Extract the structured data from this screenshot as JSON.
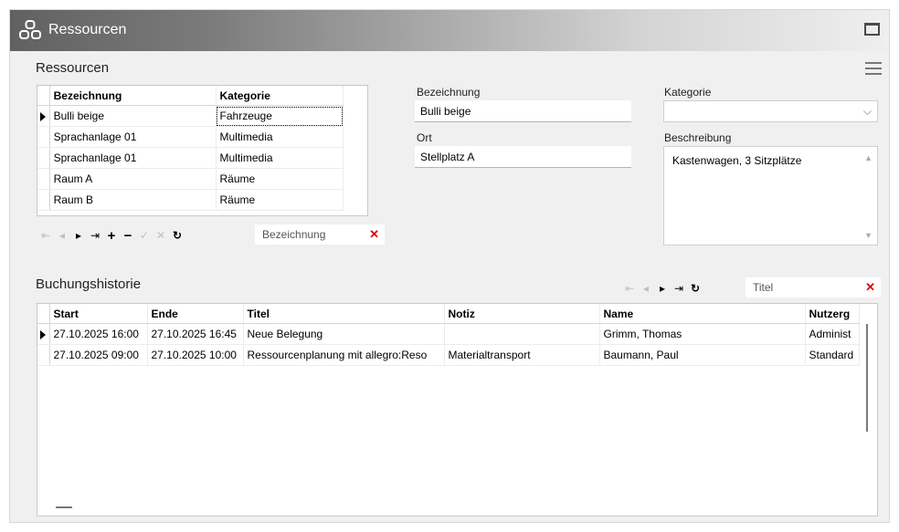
{
  "window": {
    "title": "Ressourcen"
  },
  "resources": {
    "section_title": "Ressourcen",
    "columns": [
      "Bezeichnung",
      "Kategorie"
    ],
    "rows": [
      [
        "Bulli beige",
        "Fahrzeuge"
      ],
      [
        "Sprachanlage 01",
        "Multimedia"
      ],
      [
        "Sprachanlage 01",
        "Multimedia"
      ],
      [
        "Raum A",
        "Räume"
      ],
      [
        "Raum B",
        "Räume"
      ]
    ],
    "filter_placeholder": "Bezeichnung"
  },
  "detail": {
    "bezeichnung_label": "Bezeichnung",
    "bezeichnung_value": "Bulli beige",
    "ort_label": "Ort",
    "ort_value": "Stellplatz A",
    "kategorie_label": "Kategorie",
    "kategorie_value": "",
    "beschreibung_label": "Beschreibung",
    "beschreibung_value": "Kastenwagen, 3 Sitzplätze"
  },
  "history": {
    "section_title": "Buchungshistorie",
    "filter_placeholder": "Titel",
    "columns": [
      "Start",
      "Ende",
      "Titel",
      "Notiz",
      "Name",
      "Nutzerg"
    ],
    "rows": [
      [
        "27.10.2025 16:00",
        "27.10.2025 16:45",
        "Neue Belegung",
        "",
        "Grimm, Thomas",
        "Administ"
      ],
      [
        "27.10.2025 09:00",
        "27.10.2025 10:00",
        "Ressourcenplanung mit allegro:Reso",
        "Materialtransport",
        "Baumann, Paul",
        "Standard"
      ]
    ]
  },
  "icons": {
    "first": "⇤",
    "prev": "◂",
    "next": "▸",
    "last": "⇥",
    "add": "+",
    "remove": "−",
    "confirm": "✓",
    "cancel": "✕",
    "refresh": "↻",
    "clear": "✕",
    "dropdown": "⌵",
    "scroll_up": "▲",
    "scroll_down": "▼"
  },
  "colors": {
    "clear_red": "#e00000",
    "title_gradient_start": "#616161"
  }
}
